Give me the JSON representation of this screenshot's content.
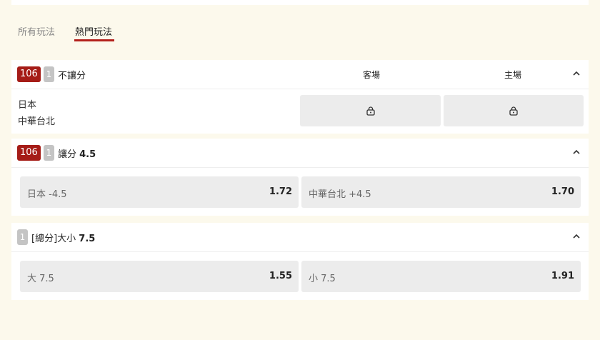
{
  "tabs": [
    {
      "label": "所有玩法",
      "active": false
    },
    {
      "label": "熱門玩法",
      "active": true
    }
  ],
  "markets": [
    {
      "badge_red": "106",
      "badge_gray": "1",
      "title": "不讓分",
      "col_away": "客場",
      "col_home": "主場",
      "team1": "日本",
      "team2": "中華台北",
      "locked": true
    },
    {
      "badge_red": "106",
      "badge_gray": "1",
      "title_prefix": "讓分 ",
      "title_value": "4.5",
      "options": [
        {
          "label": "日本 -4.5",
          "odds": "1.72"
        },
        {
          "label": "中華台北 +4.5",
          "odds": "1.70"
        }
      ]
    },
    {
      "badge_gray": "1",
      "title_prefix": "[總分]大小 ",
      "title_value": "7.5",
      "options": [
        {
          "label": "大 7.5",
          "odds": "1.55"
        },
        {
          "label": "小 7.5",
          "odds": "1.91"
        }
      ]
    }
  ],
  "colors": {
    "accent": "#a51c17",
    "background": "#fcf9ec",
    "card": "#ffffff",
    "box": "#ececec"
  },
  "icons": {
    "lock": "lock-icon",
    "collapse": "chevron-up-icon"
  }
}
